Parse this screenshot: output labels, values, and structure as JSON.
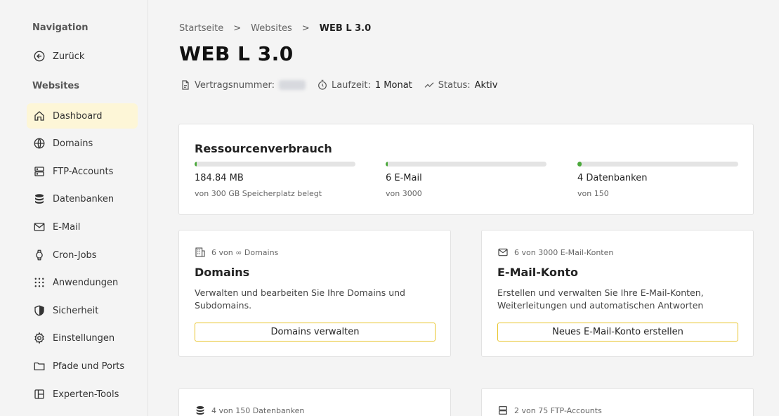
{
  "sidebar": {
    "nav_heading": "Navigation",
    "back_label": "Zurück",
    "section_heading": "Websites",
    "items": [
      {
        "label": "Dashboard",
        "icon": "home-icon"
      },
      {
        "label": "Domains",
        "icon": "globe-icon"
      },
      {
        "label": "FTP-Accounts",
        "icon": "server-icon"
      },
      {
        "label": "Datenbanken",
        "icon": "database-icon"
      },
      {
        "label": "E-Mail",
        "icon": "mail-icon"
      },
      {
        "label": "Cron-Jobs",
        "icon": "watch-icon"
      },
      {
        "label": "Anwendungen",
        "icon": "grid-dots-icon"
      },
      {
        "label": "Sicherheit",
        "icon": "shield-icon"
      },
      {
        "label": "Einstellungen",
        "icon": "gear-icon"
      },
      {
        "label": "Pfade und Ports",
        "icon": "folder-icon"
      },
      {
        "label": "Experten-Tools",
        "icon": "layout-icon"
      }
    ],
    "active_color": "#fdf6d7"
  },
  "breadcrumb": {
    "items": [
      "Startseite",
      "Websites",
      "WEB L 3.0"
    ],
    "separator": ">"
  },
  "page": {
    "title": "WEB L 3.0",
    "contract_label": "Vertragsnummer:",
    "term_label": "Laufzeit:",
    "term_value": "1 Monat",
    "status_label": "Status:",
    "status_value": "Aktiv"
  },
  "resources": {
    "title": "Ressourcenverbrauch",
    "bar_color": "#4aa83a",
    "items": [
      {
        "value": "184.84 MB",
        "sub": "von 300 GB Speicherplatz belegt",
        "fill": 0.006
      },
      {
        "value": "6 E-Mail",
        "sub": "von 3000",
        "fill": 0.01
      },
      {
        "value": "4 Datenbanken",
        "sub": "von 150",
        "fill": 0.027
      }
    ]
  },
  "tiles": {
    "domains": {
      "count": "6 von ∞ Domains",
      "title": "Domains",
      "desc": "Verwalten und bearbeiten Sie Ihre Domains und Subdomains.",
      "button": "Domains verwalten"
    },
    "email": {
      "count": "6 von 3000 E-Mail-Konten",
      "title": "E-Mail-Konto",
      "desc": "Erstellen und verwalten Sie Ihre E-Mail-Konten, Weiterleitungen und automatischen Antworten",
      "button": "Neues E-Mail-Konto erstellen"
    },
    "databases": {
      "count": "4 von 150 Datenbanken"
    },
    "ftp": {
      "count": "2 von 75 FTP-Accounts"
    }
  },
  "colors": {
    "button_border": "#e8c42a"
  }
}
